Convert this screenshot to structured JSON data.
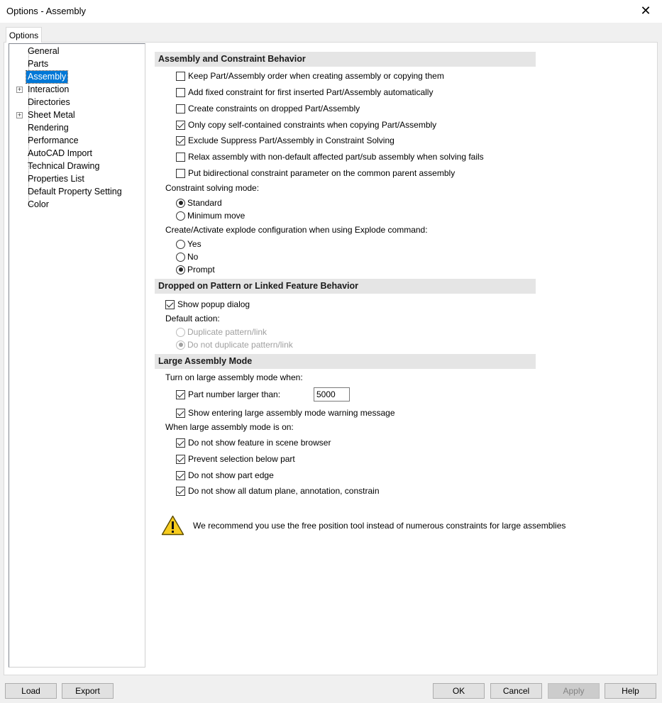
{
  "window": {
    "title": "Options - Assembly"
  },
  "tabs": [
    {
      "label": "Options"
    }
  ],
  "tree": {
    "items": [
      {
        "label": "General",
        "expandable": false
      },
      {
        "label": "Parts",
        "expandable": false
      },
      {
        "label": "Assembly",
        "expandable": false,
        "selected": true
      },
      {
        "label": "Interaction",
        "expandable": true
      },
      {
        "label": "Directories",
        "expandable": false
      },
      {
        "label": "Sheet Metal",
        "expandable": true
      },
      {
        "label": "Rendering",
        "expandable": false
      },
      {
        "label": "Performance",
        "expandable": false
      },
      {
        "label": "AutoCAD Import",
        "expandable": false
      },
      {
        "label": "Technical Drawing",
        "expandable": false
      },
      {
        "label": "Properties List",
        "expandable": false
      },
      {
        "label": "Default Property Setting",
        "expandable": false
      },
      {
        "label": "Color",
        "expandable": false
      }
    ]
  },
  "assembly_section": {
    "header": "Assembly and Constraint Behavior",
    "options": [
      {
        "label": "Keep Part/Assembly order when creating assembly or copying them",
        "checked": false
      },
      {
        "label": "Add fixed constraint for first inserted Part/Assembly automatically",
        "checked": false
      },
      {
        "label": "Create constraints on dropped Part/Assembly",
        "checked": false
      },
      {
        "label": "Only copy self-contained constraints when copying Part/Assembly",
        "checked": true
      },
      {
        "label": "Exclude Suppress Part/Assembly in Constraint Solving",
        "checked": true
      },
      {
        "label": "Relax assembly with non-default affected part/sub assembly when solving fails",
        "checked": false
      },
      {
        "label": "Put bidirectional constraint parameter on the common parent assembly",
        "checked": false
      }
    ],
    "solving_mode_label": "Constraint solving mode:",
    "solving_modes": [
      {
        "label": "Standard",
        "selected": true
      },
      {
        "label": "Minimum move",
        "selected": false
      }
    ],
    "explode_label": "Create/Activate explode configuration when using Explode command:",
    "explode_options": [
      {
        "label": "Yes",
        "selected": false
      },
      {
        "label": "No",
        "selected": false
      },
      {
        "label": "Prompt",
        "selected": true
      }
    ]
  },
  "dropped_section": {
    "header": "Dropped on Pattern or Linked Feature Behavior",
    "show_popup": {
      "label": "Show popup dialog",
      "checked": true
    },
    "default_action_label": "Default action:",
    "actions": [
      {
        "label": "Duplicate pattern/link",
        "selected": false
      },
      {
        "label": "Do not duplicate pattern/link",
        "selected": true
      }
    ]
  },
  "large_section": {
    "header": "Large Assembly Mode",
    "turn_on_label": "Turn on large assembly mode when:",
    "part_number": {
      "label": "Part number larger than:",
      "checked": true,
      "value": "5000"
    },
    "show_warning": {
      "label": "Show entering large assembly mode warning message",
      "checked": true
    },
    "when_on_label": "When large assembly mode is on:",
    "when_on_options": [
      {
        "label": "Do not show feature in scene browser",
        "checked": true
      },
      {
        "label": "Prevent selection below part",
        "checked": true
      },
      {
        "label": "Do not show part edge",
        "checked": true
      },
      {
        "label": "Do not show all datum plane, annotation, constrain",
        "checked": true
      }
    ],
    "recommendation": "We recommend you use the free position tool instead of numerous constraints for large assemblies"
  },
  "buttons": {
    "load": "Load",
    "export": "Export",
    "ok": "OK",
    "cancel": "Cancel",
    "apply": "Apply",
    "help": "Help"
  },
  "icons": {
    "close": "close-icon",
    "warning": "warning-icon"
  }
}
